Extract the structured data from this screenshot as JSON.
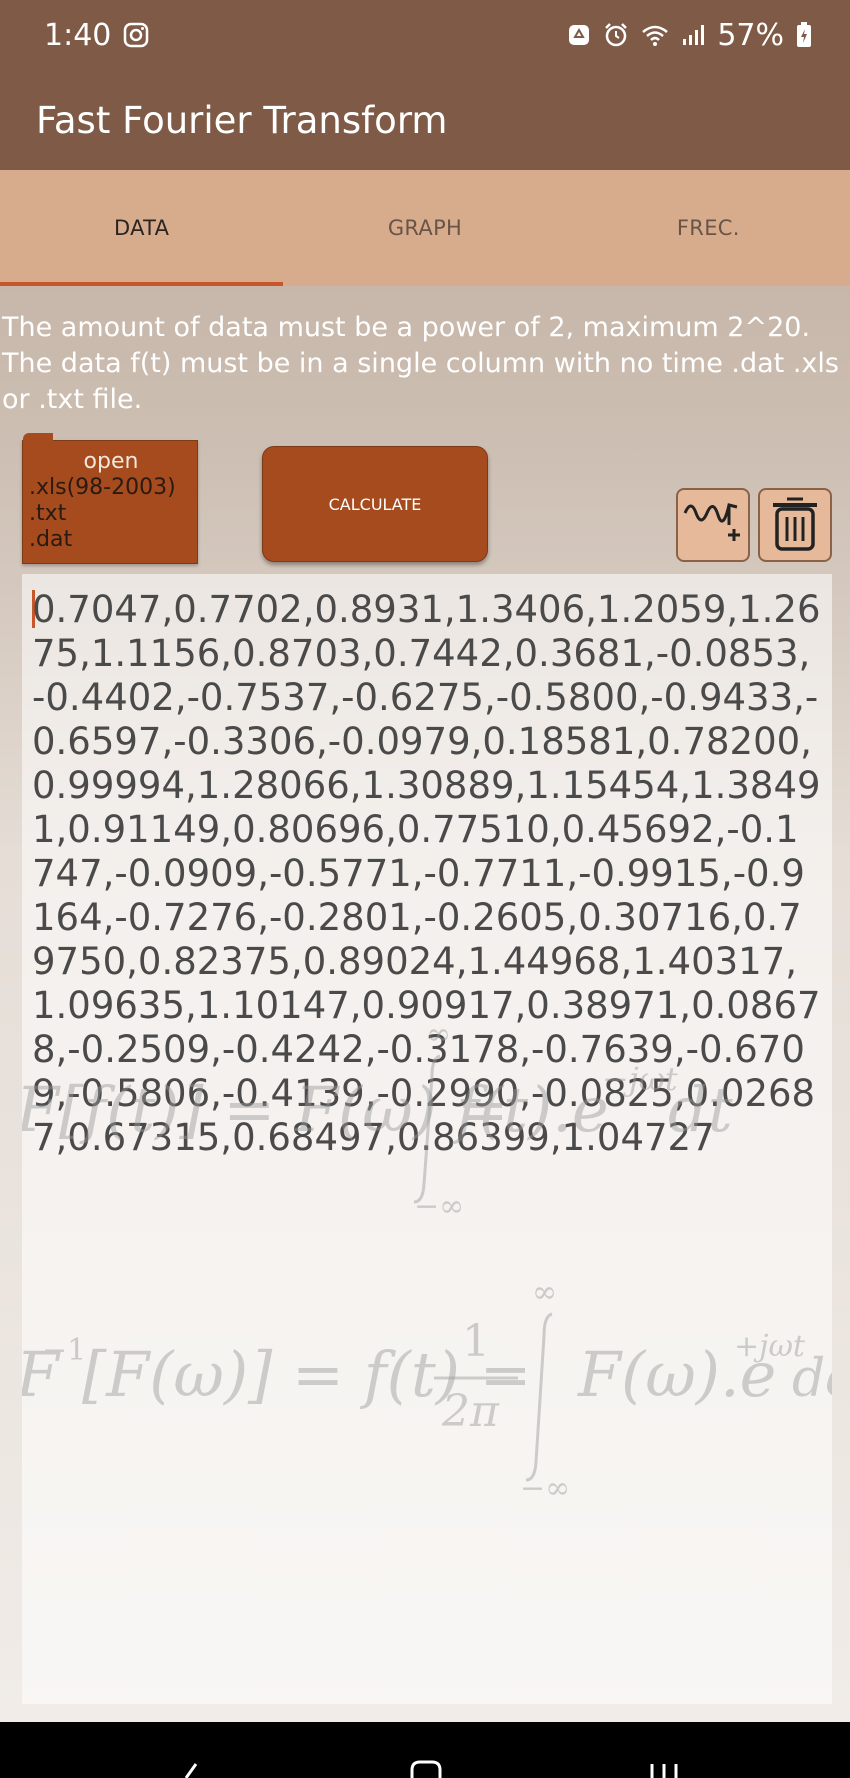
{
  "status_bar": {
    "time": "1:40",
    "battery": "57%",
    "icons": [
      "instagram-icon",
      "recycle-notification-icon",
      "alarm-icon",
      "wifi-icon",
      "signal-icon",
      "battery-charging-icon"
    ]
  },
  "app": {
    "title": "Fast Fourier Transform"
  },
  "tabs": [
    {
      "label": "DATA",
      "active": true
    },
    {
      "label": "GRAPH",
      "active": false
    },
    {
      "label": "FREC.",
      "active": false
    }
  ],
  "instructions": "The amount of data must be a power of 2, maximum 2^20. The data f(t) must be in a single column with no time .dat .xls or .txt file.",
  "open_button": {
    "title": "open",
    "formats": [
      ".xls(98-2003)",
      ".txt",
      ".dat"
    ]
  },
  "calculate_button": {
    "label": "CALCULATE"
  },
  "tool_icons": [
    "add-signal-icon",
    "trash-icon"
  ],
  "data_input": {
    "value": "0.7047,0.7702,0.8931,1.3406,1.2059,1.2675,1.1156,0.8703,0.7442,0.3681,-0.0853,-0.4402,-0.7537,-0.6275,-0.5800,-0.9433,-0.6597,-0.3306,-0.0979,0.18581,0.78200,0.99994,1.28066,1.30889,1.15454,1.38491,0.91149,0.80696,0.77510,0.45692,-0.1747,-0.0909,-0.5771,-0.7711,-0.9915,-0.9164,-0.7276,-0.2801,-0.2605,0.30716,0.79750,0.82375,0.89024,1.44968,1.40317,1.09635,1.10147,0.90917,0.38971,0.08678,-0.2509,-0.4242,-0.3178,-0.7639,-0.6709,-0.5806,-0.4139,-0.2990,-0.0825,0.02687,0.67315,0.68497,0.86399,1.04727"
  },
  "formulas": {
    "forward": {
      "lhs": "F[f(t)] = F(ω) =",
      "upper": "∞",
      "lower": "−∞",
      "integrand": "f(t).e",
      "exponent": "−jωt",
      "tail": "dt"
    },
    "inverse": {
      "lhs_head": "F",
      "lhs_sup": "−1",
      "lhs_tail": "[F(ω)] = f(t) =",
      "frac_num": "1",
      "frac_den": "2π",
      "upper": "∞",
      "lower": "−∞",
      "integrand": "F(ω).e",
      "exponent": "+jωt",
      "tail": "dω"
    }
  },
  "colors": {
    "status_bar": "#7f5a47",
    "tab_bar": "#d7ac8d",
    "tab_indicator": "#c9552a",
    "button": "#a64b1d"
  }
}
